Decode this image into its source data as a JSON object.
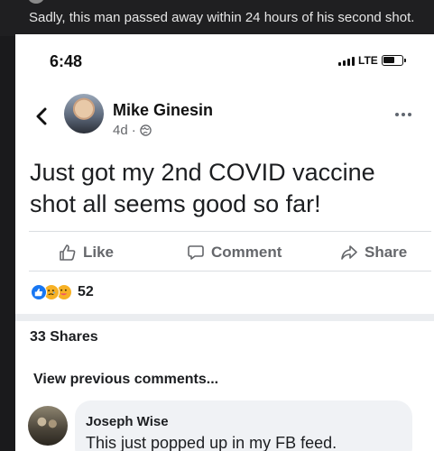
{
  "caption": {
    "text": "Sadly, this man passed away within 24 hours of his second shot."
  },
  "status_bar": {
    "time": "6:48",
    "network": "LTE",
    "icons": [
      "signal-icon",
      "battery-icon"
    ]
  },
  "post": {
    "author": "Mike Ginesin",
    "age": "4d",
    "audience_icon": "globe-icon",
    "text": "Just got my 2nd COVID vaccine shot all seems good so far!",
    "actions": {
      "like": "Like",
      "comment": "Comment",
      "share": "Share"
    },
    "reactions": [
      "like",
      "sad",
      "care"
    ],
    "reaction_count": "52",
    "shares": "33 Shares"
  },
  "comments": {
    "view_previous": "View previous comments...",
    "items": [
      {
        "name": "Joseph Wise",
        "text": "This just popped up in my FB feed."
      }
    ]
  },
  "colors": {
    "background": "#1a1a1c",
    "card": "#ffffff",
    "secondary_text": "#65676b",
    "like_blue": "#1877f2",
    "emoji_yellow": "#f7b125",
    "bubble": "#f0f2f5"
  }
}
